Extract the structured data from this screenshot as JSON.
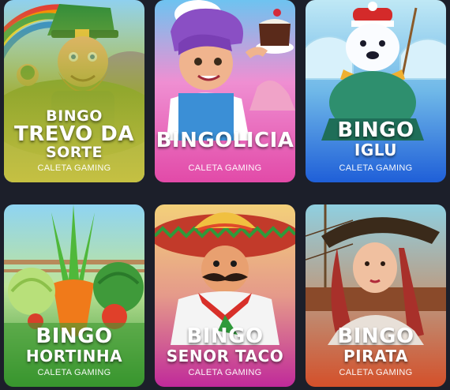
{
  "games": [
    {
      "title_lines": [
        "BINGO",
        "TREVO DA",
        "SORTE"
      ],
      "provider": "CALETA GAMING",
      "character": "leprechaun",
      "accent": "#7a9a2a"
    },
    {
      "title_lines": [
        "BINGOLICIA"
      ],
      "provider": "CALETA GAMING",
      "character": "baker-woman",
      "accent": "#e84fb0"
    },
    {
      "title_lines": [
        "BINGO",
        "IGLU"
      ],
      "provider": "CALETA GAMING",
      "character": "polar-bear",
      "accent": "#2f6fe0"
    },
    {
      "title_lines": [
        "BINGO",
        "HORTINHA"
      ],
      "provider": "CALETA GAMING",
      "character": "vegetables",
      "accent": "#3c9a2e"
    },
    {
      "title_lines": [
        "BINGO",
        "SENOR TACO"
      ],
      "provider": "CALETA GAMING",
      "character": "mexican-chef",
      "accent": "#c83aa0"
    },
    {
      "title_lines": [
        "BINGO",
        "PIRATA"
      ],
      "provider": "CALETA GAMING",
      "character": "pirate-woman",
      "accent": "#d8582a"
    }
  ]
}
